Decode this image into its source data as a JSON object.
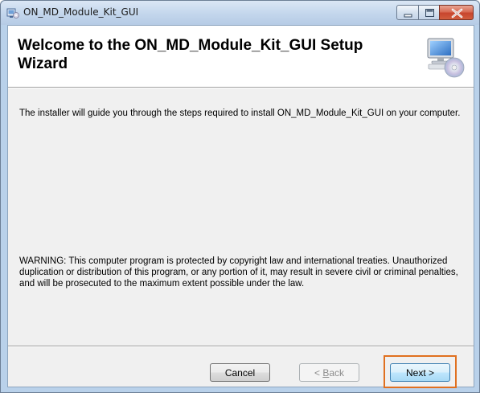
{
  "window": {
    "title": "ON_MD_Module_Kit_GUI",
    "close_color": "#c7452d"
  },
  "banner": {
    "title": "Welcome to the ON_MD_Module_Kit_GUI Setup Wizard",
    "icon": "computer-cd-icon"
  },
  "content": {
    "intro": "The installer will guide you through the steps required to install ON_MD_Module_Kit_GUI on your computer.",
    "warning": "WARNING: This computer program is protected by copyright law and international treaties. Unauthorized duplication or distribution of this program, or any portion of it, may result in severe civil or criminal penalties, and will be prosecuted to the maximum extent possible under the law."
  },
  "buttons": {
    "cancel": "Cancel",
    "back_prefix": "< ",
    "back_accel": "B",
    "back_rest": "ack",
    "next": "Next >"
  },
  "highlight_color": "#e07020"
}
